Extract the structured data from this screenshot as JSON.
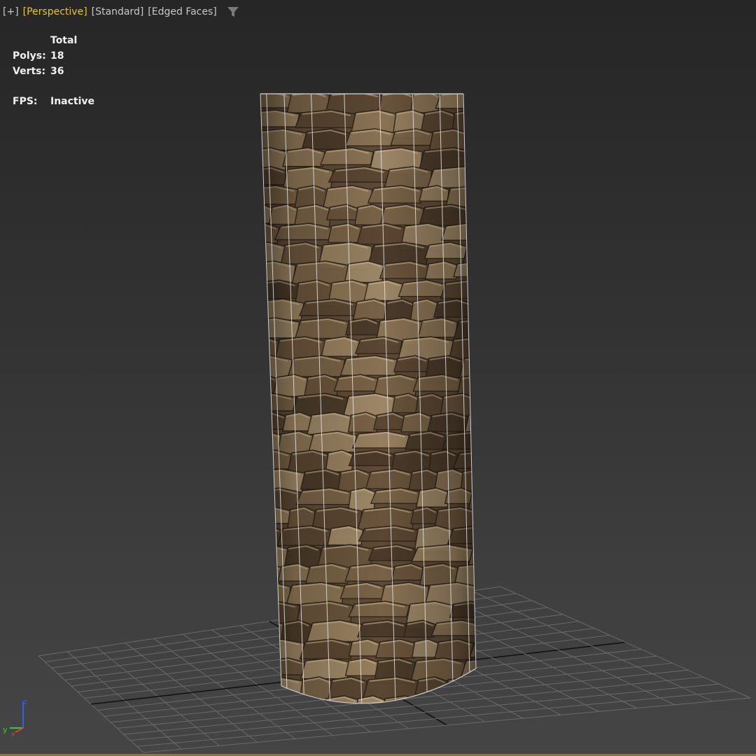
{
  "viewport_labels": {
    "plus": "[+]",
    "view": "[Perspective]",
    "shading": "[Standard]",
    "edged": "[Edged Faces]"
  },
  "icons": {
    "filter": "funnel-icon",
    "axis_tripod": "axis-tripod-icon"
  },
  "stats": {
    "header": "Total",
    "polys_label": "Polys:",
    "polys_value": "18",
    "verts_label": "Verts:",
    "verts_value": "36",
    "fps_label": "FPS:",
    "fps_value": "Inactive"
  },
  "axis": {
    "z_label": "z",
    "y_label": "y",
    "x_label": "x"
  },
  "colors": {
    "active_label": "#e6c52a",
    "label": "#c8c8c8",
    "stats_text": "#f0f0f0",
    "grid_line": "#6a6a6a",
    "grid_axis": "#111111",
    "axis_z": "#3a5ae8",
    "axis_y": "#3cc83c",
    "axis_x": "#e03a3a"
  }
}
